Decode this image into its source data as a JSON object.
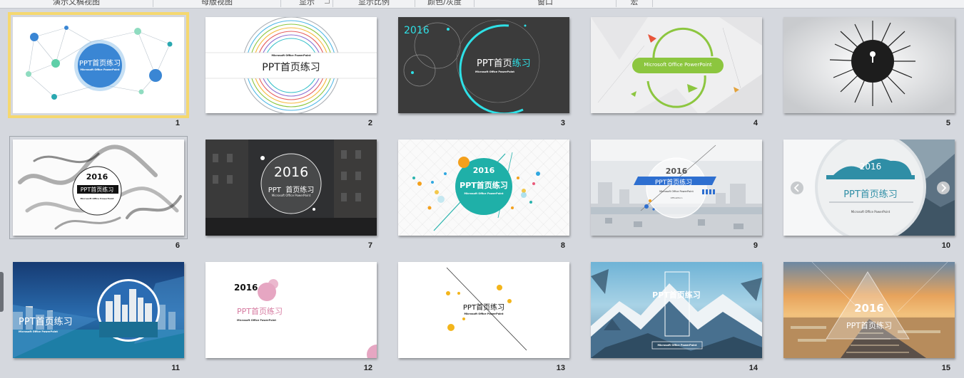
{
  "ribbon": {
    "groups": [
      {
        "label": "演示文稿视图"
      },
      {
        "label": "母版视图"
      },
      {
        "label": "显示"
      },
      {
        "label": "显示比例"
      },
      {
        "label": "颜色/灰度"
      },
      {
        "label": "窗口"
      },
      {
        "label": "宏"
      }
    ]
  },
  "slides": [
    {
      "number": "1",
      "title": "PPT首页练习",
      "subtitle": "Microsoft Office PowerPoint"
    },
    {
      "number": "2",
      "title": "PPT首页练习",
      "subtitle": "Microsoft Office PowerPoint"
    },
    {
      "number": "3",
      "year": "2016",
      "title": "PPT首页",
      "title_accent": "练习",
      "subtitle": "Microsoft Office PowerPoint"
    },
    {
      "number": "4",
      "subtitle": "Microsoft Office PowerPoint"
    },
    {
      "number": "5"
    },
    {
      "number": "6",
      "year": "2016",
      "title": "PPT首页练习",
      "subtitle": "Microsoft Office PowerPoint"
    },
    {
      "number": "7",
      "year": "2016",
      "title": "PPT  首页练习",
      "subtitle": "Microsoft Office PowerPoint"
    },
    {
      "number": "8",
      "year": "2016",
      "title": "PPT首页练习",
      "subtitle": "Microsoft Office PowerPoint"
    },
    {
      "number": "9",
      "year": "2016",
      "title": "PPT首页练习",
      "subtitle": "Microsoft Office PowerPoint",
      "tag": "OfficeMicro"
    },
    {
      "number": "10",
      "year": "2016",
      "title": "PPT首页练习",
      "subtitle": "Microsoft Office PowerPoint"
    },
    {
      "number": "11",
      "title": "PPT首页练习",
      "subtitle": "Microsoft Office PowerPoint"
    },
    {
      "number": "12",
      "year": "2016",
      "title": "PPT首页练习",
      "subtitle": "Microsoft Office PowerPoint"
    },
    {
      "number": "13",
      "title": "PPT首页练习",
      "subtitle": "Microsoft Office PowerPoint"
    },
    {
      "number": "14",
      "title": "PPT首页练习",
      "subtitle": "Microsoft Office PowerPoint"
    },
    {
      "number": "15",
      "year": "2016",
      "title": "PPT首页练习"
    }
  ],
  "colors": {
    "selection": "#f5d870",
    "accent_cyan": "#2ecad3",
    "accent_blue": "#3a86d4",
    "accent_green": "#8cc63f"
  }
}
